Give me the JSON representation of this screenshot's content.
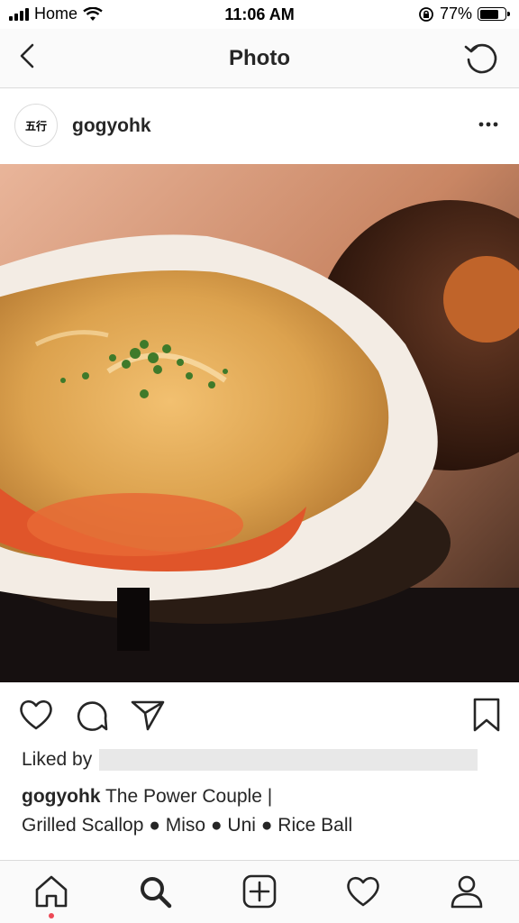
{
  "status_bar": {
    "carrier": "Home",
    "time": "11:06 AM",
    "battery_percent": "77%",
    "battery_level": 0.77
  },
  "nav": {
    "title": "Photo"
  },
  "post": {
    "username": "gogyohk",
    "avatar_text": "五行",
    "liked_by_prefix": "Liked by",
    "caption_user": "gogyohk",
    "caption_line1": "The Power Couple |",
    "caption_line2": "Grilled Scallop ● Miso ● Uni ● Rice Ball"
  },
  "icons": {
    "back": "chevron-left-icon",
    "refresh": "refresh-icon",
    "more": "more-horizontal-icon",
    "like": "heart-icon",
    "comment": "comment-icon",
    "share": "send-icon",
    "save": "bookmark-icon",
    "home": "home-icon",
    "search": "search-icon",
    "new_post": "plus-square-icon",
    "activity": "heart-icon",
    "profile": "profile-icon"
  },
  "colors": {
    "notification_dot": "#ed4956",
    "text": "#262626",
    "divider": "#dbdbdb"
  }
}
